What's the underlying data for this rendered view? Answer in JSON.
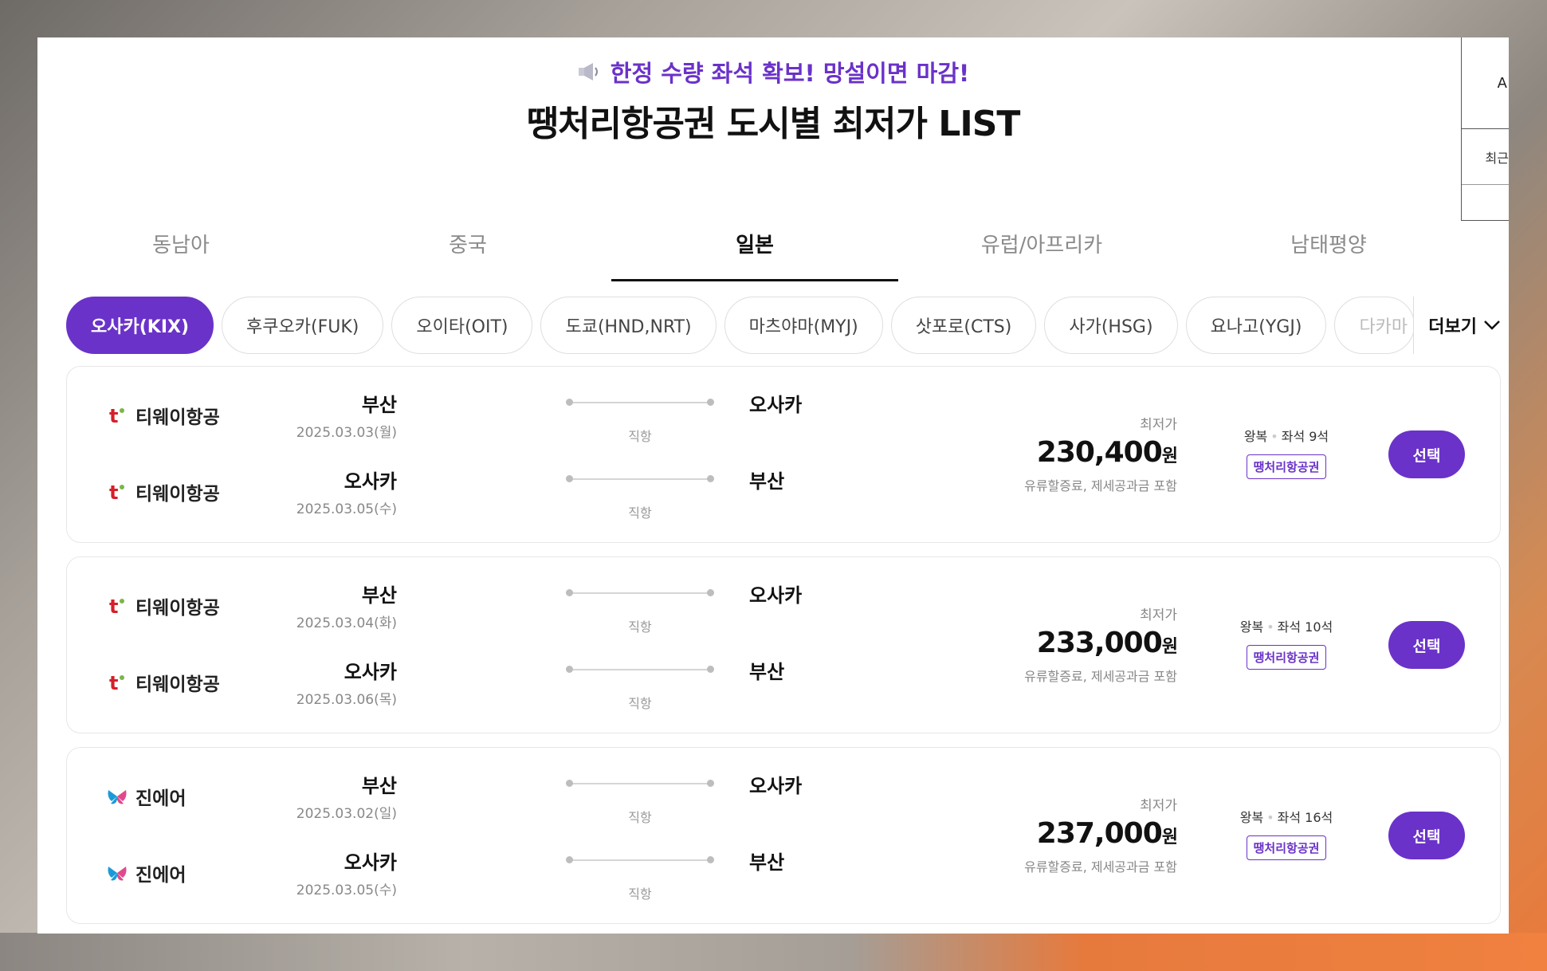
{
  "banner": {
    "subtitle": "한정 수량 좌석 확보! 망설이면 마감!",
    "title": "땡처리항공권 도시별 최저가 LIST"
  },
  "side_widget": {
    "top_text": "A",
    "mid_text": "최근"
  },
  "region_tabs": [
    {
      "label": "동남아",
      "active": false
    },
    {
      "label": "중국",
      "active": false
    },
    {
      "label": "일본",
      "active": true
    },
    {
      "label": "유럽/아프리카",
      "active": false
    },
    {
      "label": "남태평양",
      "active": false
    }
  ],
  "city_chips": [
    {
      "label": "오사카(KIX)",
      "active": true
    },
    {
      "label": "후쿠오카(FUK)",
      "active": false
    },
    {
      "label": "오이타(OIT)",
      "active": false
    },
    {
      "label": "도쿄(HND,NRT)",
      "active": false
    },
    {
      "label": "마츠야마(MYJ)",
      "active": false
    },
    {
      "label": "삿포로(CTS)",
      "active": false
    },
    {
      "label": "사가(HSG)",
      "active": false
    },
    {
      "label": "요나고(YGJ)",
      "active": false
    },
    {
      "label": "다카마",
      "active": false
    }
  ],
  "more_label": "더보기",
  "cards": [
    {
      "legs": [
        {
          "airline": "티웨이항공",
          "from": "부산",
          "date": "2025.03.03(월)",
          "type": "직항",
          "to": "오사카"
        },
        {
          "airline": "티웨이항공",
          "from": "오사카",
          "date": "2025.03.05(수)",
          "type": "직항",
          "to": "부산"
        }
      ],
      "price_label": "최저가",
      "price": "230,400",
      "unit": "원",
      "note": "유류할증료, 제세공과금 포함",
      "trip": "왕복",
      "seats": "좌석 9석",
      "badge": "땡처리항공권",
      "button": "선택"
    },
    {
      "legs": [
        {
          "airline": "티웨이항공",
          "from": "부산",
          "date": "2025.03.04(화)",
          "type": "직항",
          "to": "오사카"
        },
        {
          "airline": "티웨이항공",
          "from": "오사카",
          "date": "2025.03.06(목)",
          "type": "직항",
          "to": "부산"
        }
      ],
      "price_label": "최저가",
      "price": "233,000",
      "unit": "원",
      "note": "유류할증료, 제세공과금 포함",
      "trip": "왕복",
      "seats": "좌석 10석",
      "badge": "땡처리항공권",
      "button": "선택"
    },
    {
      "legs": [
        {
          "airline": "진에어",
          "from": "부산",
          "date": "2025.03.02(일)",
          "type": "직항",
          "to": "오사카"
        },
        {
          "airline": "진에어",
          "from": "오사카",
          "date": "2025.03.05(수)",
          "type": "직항",
          "to": "부산"
        }
      ],
      "price_label": "최저가",
      "price": "237,000",
      "unit": "원",
      "note": "유류할증료, 제세공과금 포함",
      "trip": "왕복",
      "seats": "좌석 16석",
      "badge": "땡처리항공권",
      "button": "선택"
    }
  ],
  "colors": {
    "accent": "#6a32c9",
    "tway": "#d4202a",
    "jinair_blue": "#1d9ad6",
    "jinair_pink": "#e04a8c"
  }
}
